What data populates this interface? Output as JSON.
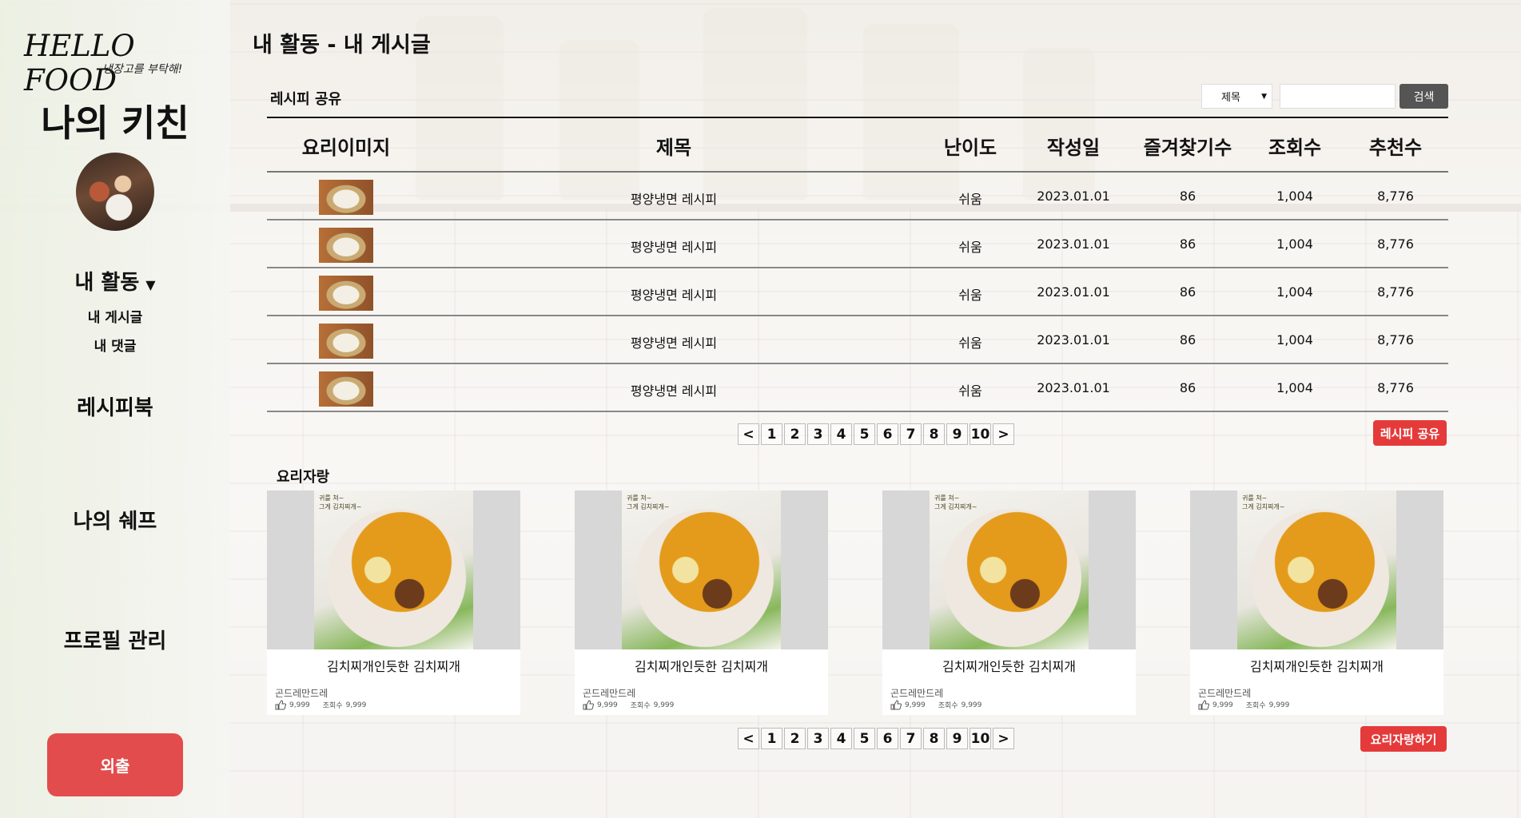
{
  "brand": {
    "name": "HELLO FOOD",
    "tagline": "냉장고를 부탁해!"
  },
  "sidebar": {
    "heading": "나의 키친",
    "menu": [
      {
        "label": "내 활동",
        "expanded": true,
        "children": [
          "내 게시글",
          "내 댓글"
        ]
      },
      {
        "label": "레시피북"
      },
      {
        "label": "나의 쉐프"
      },
      {
        "label": "프로필 관리"
      }
    ],
    "logout_label": "외출"
  },
  "page": {
    "title": "내 활동 - 내 게시글"
  },
  "recipe_share": {
    "label": "레시피 공유",
    "search": {
      "select_value": "제목",
      "input_value": "",
      "button_label": "검색"
    },
    "columns": [
      "요리이미지",
      "제목",
      "난이도",
      "작성일",
      "즐겨찾기수",
      "조회수",
      "추천수"
    ],
    "rows": [
      {
        "title": "평양냉면 레시피",
        "difficulty": "쉬움",
        "date": "2023.01.01",
        "favorites": "86",
        "views": "1,004",
        "recommends": "8,776"
      },
      {
        "title": "평양냉면 레시피",
        "difficulty": "쉬움",
        "date": "2023.01.01",
        "favorites": "86",
        "views": "1,004",
        "recommends": "8,776"
      },
      {
        "title": "평양냉면 레시피",
        "difficulty": "쉬움",
        "date": "2023.01.01",
        "favorites": "86",
        "views": "1,004",
        "recommends": "8,776"
      },
      {
        "title": "평양냉면 레시피",
        "difficulty": "쉬움",
        "date": "2023.01.01",
        "favorites": "86",
        "views": "1,004",
        "recommends": "8,776"
      },
      {
        "title": "평양냉면 레시피",
        "difficulty": "쉬움",
        "date": "2023.01.01",
        "favorites": "86",
        "views": "1,004",
        "recommends": "8,776"
      }
    ],
    "pagination": [
      "<",
      "1",
      "2",
      "3",
      "4",
      "5",
      "6",
      "7",
      "8",
      "9",
      "10",
      ">"
    ],
    "action_label": "레시피 공유"
  },
  "cooking_boast": {
    "label": "요리자랑",
    "cards": [
      {
        "title": "김치찌개인듯한 김치찌개",
        "author": "곤드레만드레",
        "likes": "9,999",
        "views_label": "조회수",
        "views": "9,999",
        "photo_caption": "귀를 쳐~\n그게 김치찌개~"
      },
      {
        "title": "김치찌개인듯한 김치찌개",
        "author": "곤드레만드레",
        "likes": "9,999",
        "views_label": "조회수",
        "views": "9,999",
        "photo_caption": "귀를 쳐~\n그게 김치찌개~"
      },
      {
        "title": "김치찌개인듯한 김치찌개",
        "author": "곤드레만드레",
        "likes": "9,999",
        "views_label": "조회수",
        "views": "9,999",
        "photo_caption": "귀를 쳐~\n그게 김치찌개~"
      },
      {
        "title": "김치찌개인듯한 김치찌개",
        "author": "곤드레만드레",
        "likes": "9,999",
        "views_label": "조회수",
        "views": "9,999",
        "photo_caption": "귀를 쳐~\n그게 김치찌개~"
      }
    ],
    "pagination": [
      "<",
      "1",
      "2",
      "3",
      "4",
      "5",
      "6",
      "7",
      "8",
      "9",
      "10",
      ">"
    ],
    "action_label": "요리자랑하기"
  },
  "colors": {
    "accent_red": "#e53a3a",
    "logout_red": "#e34c4c",
    "search_button": "#555555"
  }
}
